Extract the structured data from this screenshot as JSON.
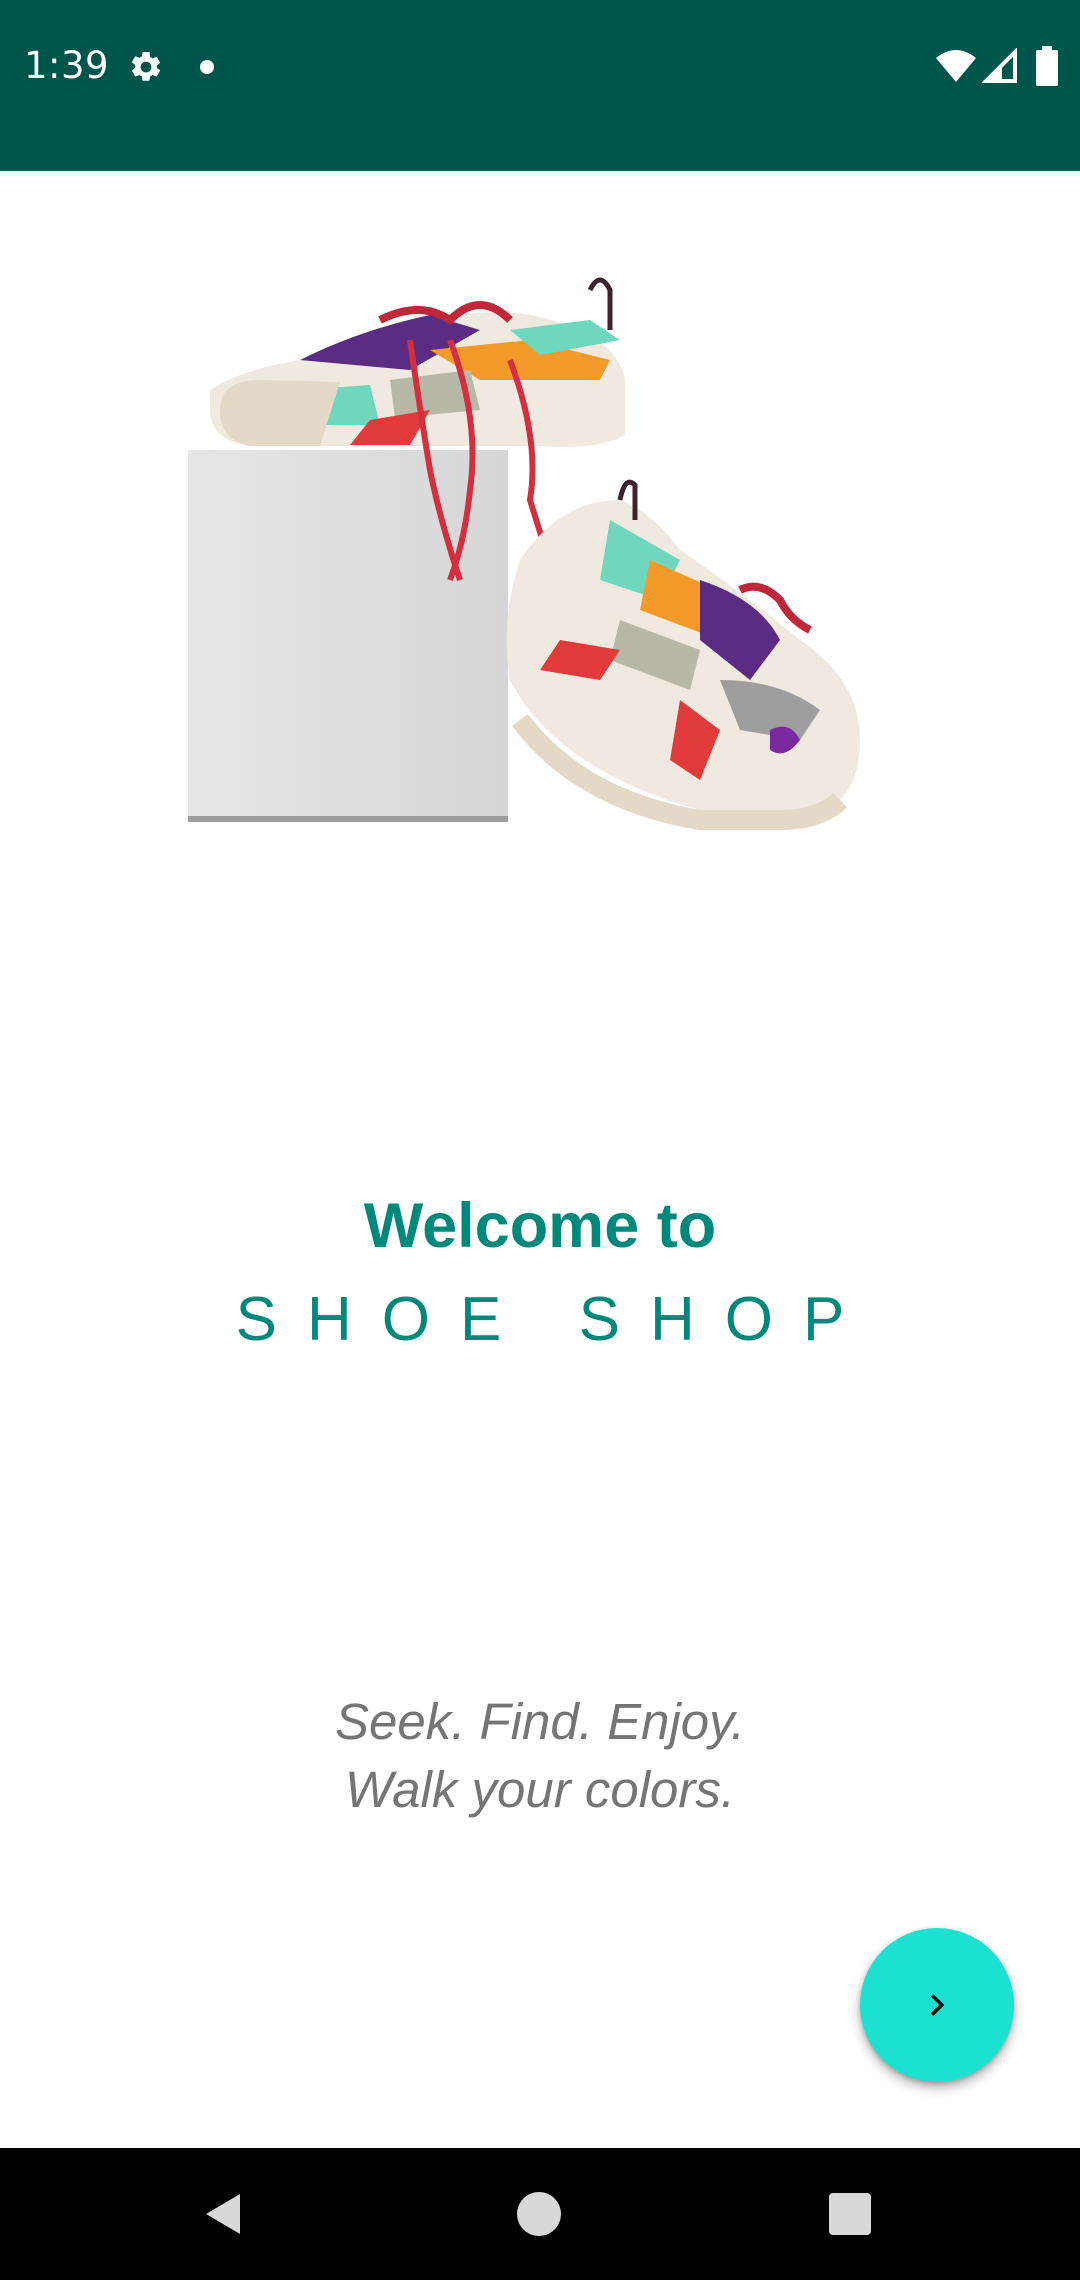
{
  "status_bar": {
    "time": "1:39",
    "background_color": "#00554B",
    "icons": [
      "gear-icon",
      "notification-dot-icon",
      "wifi-icon",
      "signal-icon",
      "battery-icon"
    ]
  },
  "hero": {
    "image": "sneakers-on-box-illustration"
  },
  "welcome": {
    "title": "Welcome to",
    "shop_name": "SHOE SHOP",
    "accent_color": "#00897B"
  },
  "tagline": {
    "line1": "Seek. Find. Enjoy.",
    "line2": "Walk your colors."
  },
  "fab": {
    "icon": "chevron-right-icon",
    "color": "#1DE1D0"
  },
  "nav_bar": {
    "icons": [
      "back-icon",
      "home-icon",
      "recents-icon"
    ]
  }
}
